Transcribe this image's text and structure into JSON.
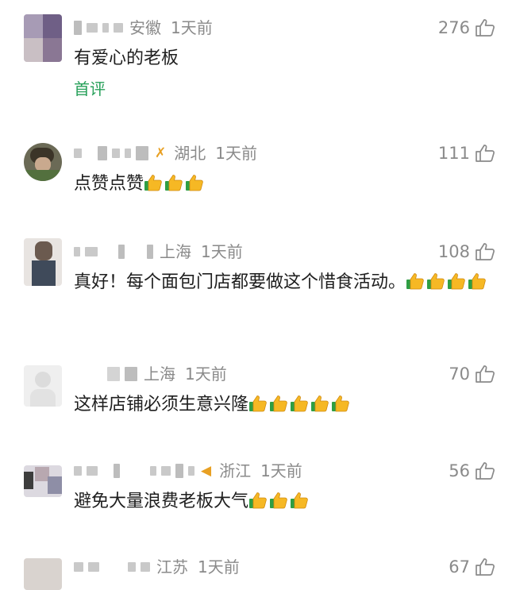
{
  "colors": {
    "meta": "#8a8a8a",
    "text": "#1e1e1e",
    "tag": "#27a05a",
    "badge": "#e8a023"
  },
  "comments": [
    {
      "region": "安徽",
      "time": "1天前",
      "likes": "276",
      "text": "有爱心的老板",
      "tag": "首评",
      "emoji_count": 0
    },
    {
      "region": "湖北",
      "time": "1天前",
      "likes": "111",
      "text": "点赞点赞",
      "emoji_count": 3
    },
    {
      "region": "上海",
      "time": "1天前",
      "likes": "108",
      "text": "真好！每个面包门店都要做这个惜食活动。",
      "emoji_count": 4
    },
    {
      "region": "上海",
      "time": "1天前",
      "likes": "70",
      "text": "这样店铺必须生意兴隆",
      "emoji_count": 5
    },
    {
      "region": "浙江",
      "time": "1天前",
      "likes": "56",
      "text": "避免大量浪费老板大气",
      "emoji_count": 3
    },
    {
      "region": "江苏",
      "time": "1天前",
      "likes": "67"
    }
  ]
}
